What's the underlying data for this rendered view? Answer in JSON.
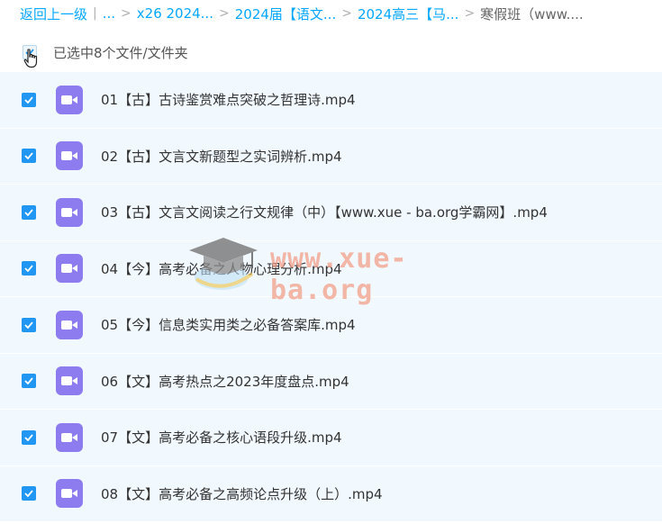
{
  "breadcrumb": {
    "back": "返回上一级",
    "sep1": "|",
    "ellipsis": "...",
    "items": [
      "x26 2024...",
      "2024届【语文...",
      "2024高三【马...",
      "寒假班（www...."
    ]
  },
  "selection": {
    "text": "已选中8个文件/文件夹"
  },
  "files": [
    {
      "name": "01【古】古诗鉴赏难点突破之哲理诗.mp4",
      "checked": true
    },
    {
      "name": "02【古】文言文新题型之实词辨析.mp4",
      "checked": true
    },
    {
      "name": "03【古】文言文阅读之行文规律（中）【www.xue - ba.org学霸网】.mp4",
      "checked": true
    },
    {
      "name": "04【今】高考必备之人物心理分析.mp4",
      "checked": true
    },
    {
      "name": "05【今】信息类实用类之必备答案库.mp4",
      "checked": true
    },
    {
      "name": "06【文】高考热点之2023年度盘点.mp4",
      "checked": true
    },
    {
      "name": "07【文】高考必备之核心语段升级.mp4",
      "checked": true
    },
    {
      "name": "08【文】高考必备之高频论点升级（上）.mp4",
      "checked": true
    }
  ],
  "watermark": {
    "text": "www.xue-ba.org"
  },
  "colors": {
    "accent": "#06a7ff",
    "checkbox": "#2196f3",
    "video_icon": "#8c7cf0",
    "row_bg": "#f1f8fe"
  },
  "icons": {
    "file": "video-file-icon",
    "check": "check-icon",
    "cursor": "hand-cursor-icon"
  }
}
